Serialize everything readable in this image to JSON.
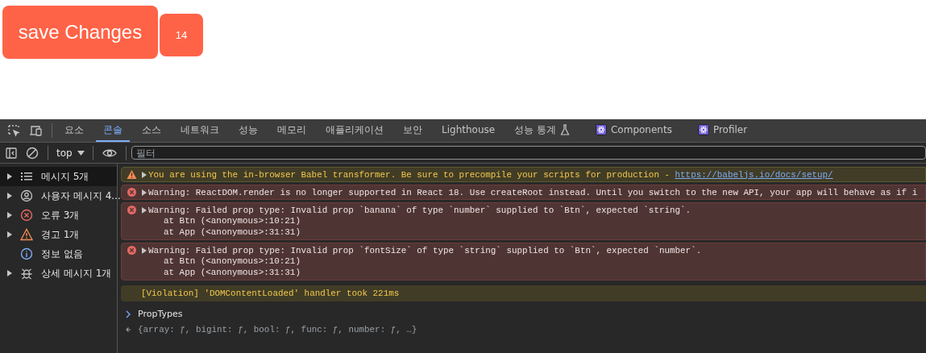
{
  "page": {
    "buttons": [
      {
        "label": "save Changes",
        "kind": "large"
      },
      {
        "label": "14",
        "kind": "small"
      }
    ]
  },
  "devtools": {
    "tabs": [
      {
        "label": "요소",
        "selected": false,
        "kind": "plain"
      },
      {
        "label": "콘솔",
        "selected": true,
        "kind": "plain"
      },
      {
        "label": "소스",
        "selected": false,
        "kind": "plain"
      },
      {
        "label": "네트워크",
        "selected": false,
        "kind": "plain"
      },
      {
        "label": "성능",
        "selected": false,
        "kind": "plain"
      },
      {
        "label": "메모리",
        "selected": false,
        "kind": "plain"
      },
      {
        "label": "애플리케이션",
        "selected": false,
        "kind": "plain"
      },
      {
        "label": "보안",
        "selected": false,
        "kind": "plain"
      },
      {
        "label": "Lighthouse",
        "selected": false,
        "kind": "plain"
      },
      {
        "label": "성능 통계",
        "selected": false,
        "kind": "experimental"
      },
      {
        "label": "Components",
        "selected": false,
        "kind": "extension"
      },
      {
        "label": "Profiler",
        "selected": false,
        "kind": "extension"
      }
    ],
    "toolbar": {
      "context": "top",
      "filter_placeholder": "필터"
    },
    "sidebar": {
      "items": [
        {
          "label": "메시지 5개",
          "kind": "messages",
          "expandable": true,
          "selected": true
        },
        {
          "label": "사용자 메시지 4...",
          "kind": "user",
          "expandable": true,
          "selected": false
        },
        {
          "label": "오류 3개",
          "kind": "error",
          "expandable": true,
          "selected": false
        },
        {
          "label": "경고 1개",
          "kind": "warning",
          "expandable": true,
          "selected": false
        },
        {
          "label": "정보 없음",
          "kind": "info",
          "expandable": false,
          "selected": false
        },
        {
          "label": "상세 메시지 1개",
          "kind": "verbose",
          "expandable": true,
          "selected": false
        }
      ]
    },
    "console": [
      {
        "kind": "warning",
        "text": "You are using the in-browser Babel transformer. Be sure to precompile your scripts for production - ",
        "link": "https://babeljs.io/docs/setup/"
      },
      {
        "kind": "error",
        "text": "Warning: ReactDOM.render is no longer supported in React 18. Use createRoot instead. Until you switch to the new API, your app will behave as if i"
      },
      {
        "kind": "error",
        "text": "Warning: Failed prop type: Invalid prop `banana` of type `number` supplied to `Btn`, expected `string`.",
        "stack": [
          "at Btn (<anonymous>:10:21)",
          "at App (<anonymous>:31:31)"
        ]
      },
      {
        "kind": "error",
        "text": "Warning: Failed prop type: Invalid prop `fontSize` of type `string` supplied to `Btn`, expected `number`.",
        "stack": [
          "at Btn (<anonymous>:10:21)",
          "at App (<anonymous>:31:31)"
        ]
      },
      {
        "kind": "violation",
        "text": "[Violation] 'DOMContentLoaded' handler took 221ms"
      },
      {
        "kind": "input",
        "text": "PropTypes"
      },
      {
        "kind": "output",
        "text": "{array: ƒ, bigint: ƒ, bool: ƒ, func: ƒ, number: ƒ, …}"
      }
    ]
  }
}
